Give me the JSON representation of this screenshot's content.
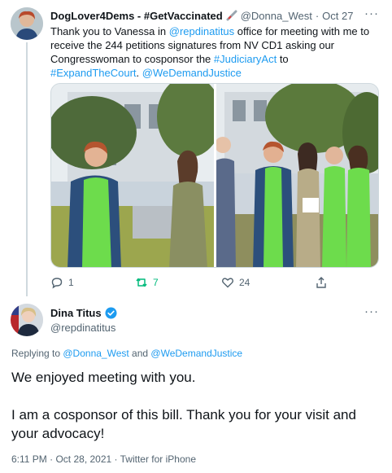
{
  "parent_tweet": {
    "display_name": "DogLover4Dems - #GetVaccinated",
    "handle": "@Donna_West",
    "separator": "·",
    "date": "Oct 27",
    "text_part1": "Thank you to Vanessa in ",
    "mention1": "@repdinatitus",
    "text_part2": " office for meeting with me to receive the 244 petitions signatures from NV CD1 asking our Congresswoman to cosponsor the ",
    "hashtag1": "#JudiciaryAct",
    "text_part3": " to ",
    "hashtag2": "#ExpandTheCourt",
    "text_part4": ". ",
    "mention2": "@WeDemandJustice",
    "more_label": "···",
    "actions": {
      "reply_count": "1",
      "retweet_count": "7",
      "like_count": "24"
    },
    "colors": {
      "retweeted": "#00ba7c"
    }
  },
  "reply_tweet": {
    "display_name": "Dina Titus",
    "handle": "@repdinatitus",
    "more_label": "···",
    "replying_prefix": "Replying to ",
    "replying_to_1": "@Donna_West",
    "replying_and": " and ",
    "replying_to_2": "@WeDemandJustice",
    "line1": "We enjoyed meeting with you.",
    "line2": "I am a cosponsor of this bill. Thank you for your visit and your advocacy!",
    "timestamp": "6:11 PM · Oct 28, 2021 · Twitter for iPhone"
  },
  "colors": {
    "link": "#1d9bf0",
    "muted": "#536471",
    "text": "#0f1419"
  }
}
